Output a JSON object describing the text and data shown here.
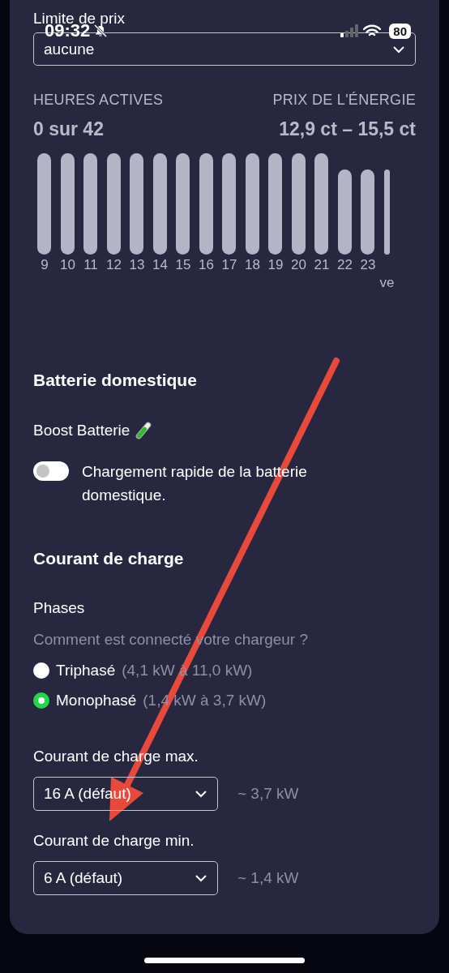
{
  "status_bar": {
    "time": "09:32",
    "battery": "80"
  },
  "price_limit": {
    "label": "Limite de prix",
    "value": "aucune"
  },
  "stats": [
    {
      "label": "HEURES ACTIVES",
      "value": "0 sur 42"
    },
    {
      "label": "PRIX DE L'ÉNERGIE",
      "value": "12,9 ct – 15,5 ct"
    }
  ],
  "hours": [
    {
      "label": "9",
      "kind": "tall"
    },
    {
      "label": "10",
      "kind": "tall"
    },
    {
      "label": "11",
      "kind": "tall"
    },
    {
      "label": "12",
      "kind": "tall"
    },
    {
      "label": "13",
      "kind": "tall"
    },
    {
      "label": "14",
      "kind": "tall"
    },
    {
      "label": "15",
      "kind": "tall"
    },
    {
      "label": "16",
      "kind": "tall"
    },
    {
      "label": "17",
      "kind": "tall"
    },
    {
      "label": "18",
      "kind": "tall"
    },
    {
      "label": "19",
      "kind": "tall"
    },
    {
      "label": "20",
      "kind": "tall"
    },
    {
      "label": "21",
      "kind": "tall"
    },
    {
      "label": "22",
      "kind": "short"
    },
    {
      "label": "23",
      "kind": "short"
    },
    {
      "sublabel": "ve",
      "kind": "short"
    }
  ],
  "home_battery": {
    "title": "Batterie domestique",
    "boost_label": "Boost Batterie",
    "toggle": {
      "on": false,
      "text": "Chargement rapide de la batterie domestique."
    }
  },
  "charge_current": {
    "title": "Courant de charge",
    "phases_label": "Phases",
    "question": "Comment est connecté votre chargeur ?",
    "phases": [
      {
        "name": "Triphasé",
        "range": "(4,1 kW à 11,0 kW)",
        "selected": false
      },
      {
        "name": "Monophasé",
        "range": "(1,4 kW à 3,7 kW)",
        "selected": true
      }
    ],
    "limits": [
      {
        "label": "Courant de charge max.",
        "value": "16 A (défaut)",
        "power": "~ 3,7 kW"
      },
      {
        "label": "Courant de charge min.",
        "value": "6 A (défaut)",
        "power": "~ 1,4 kW"
      }
    ]
  }
}
